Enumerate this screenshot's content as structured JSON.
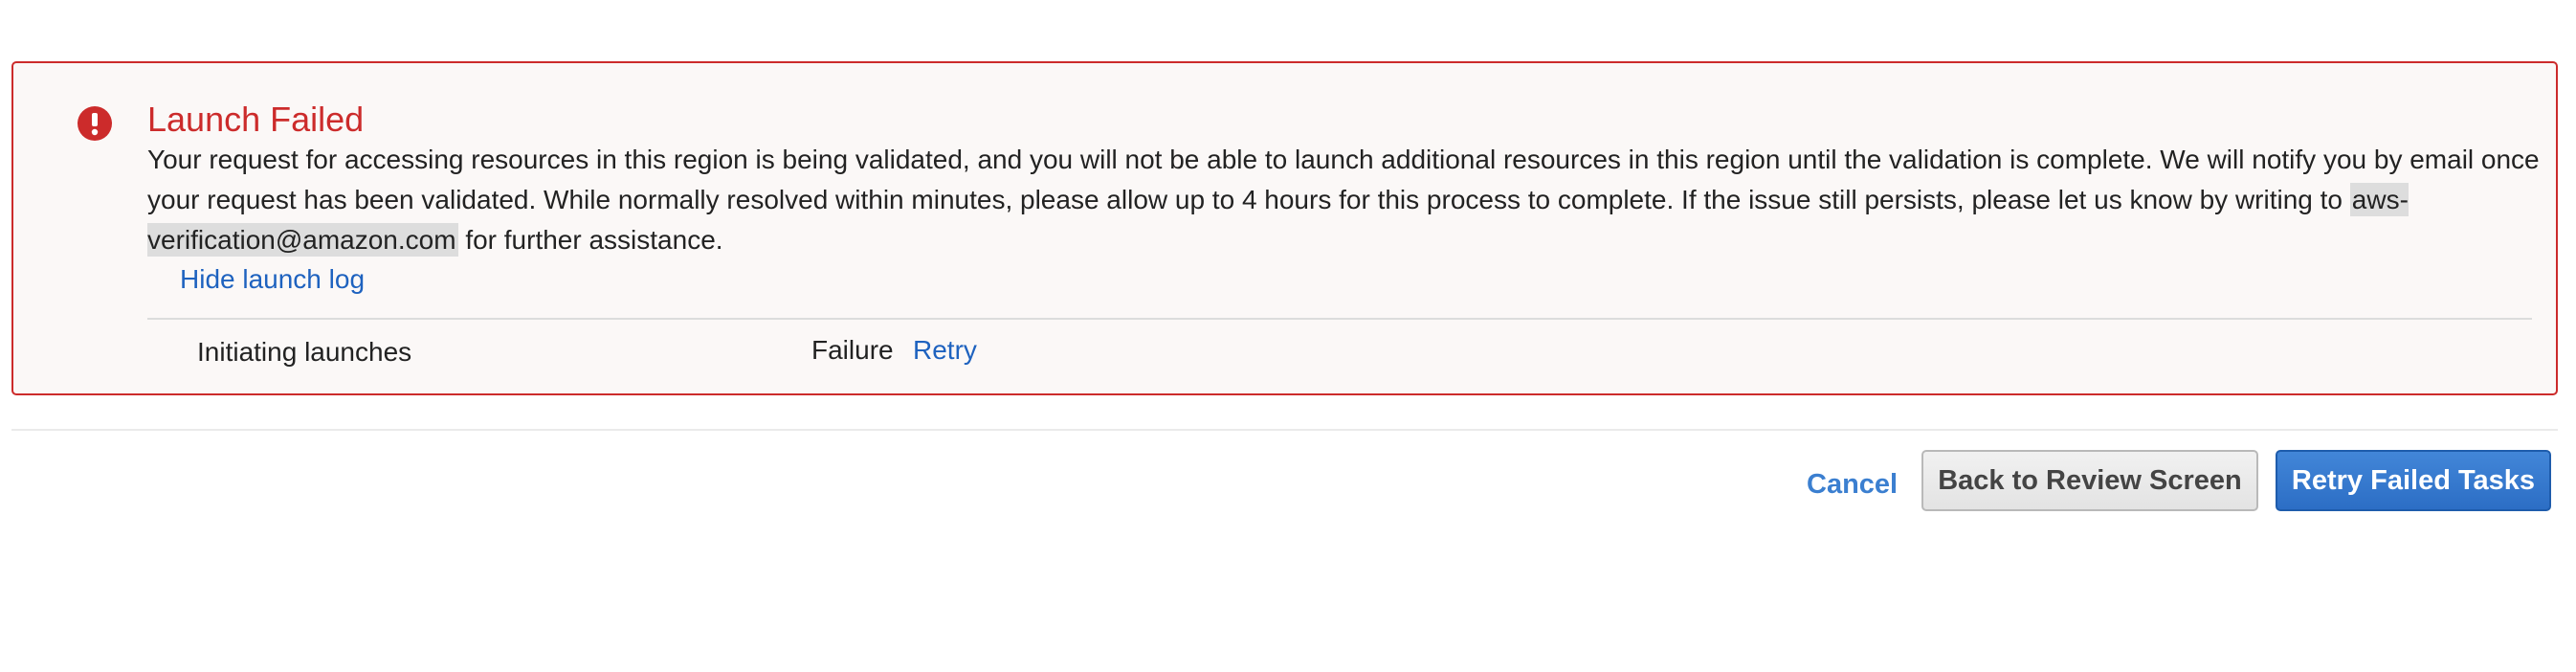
{
  "alert": {
    "icon": "exclamation-circle-icon",
    "title": "Launch Failed",
    "message_before_email": "Your request for accessing resources in this region is being validated, and you will not be able to launch additional resources in this region until the validation is complete. We will notify you by email once your request has been validated. While normally resolved within minutes, please allow up to 4 hours for this process to complete. If the issue still persists, please let us know by writing to ",
    "email": "aws-verification@amazon.com",
    "message_after_email": " for further assistance.",
    "hide_log_label": "Hide launch log",
    "color": "#cc2b2b"
  },
  "launch_log": {
    "rows": [
      {
        "task": "Initiating launches",
        "status": "Failure",
        "action": "Retry"
      }
    ]
  },
  "footer": {
    "cancel_label": "Cancel",
    "back_label": "Back to Review Screen",
    "retry_label": "Retry Failed Tasks",
    "accent_color": "#2c6ec5"
  }
}
